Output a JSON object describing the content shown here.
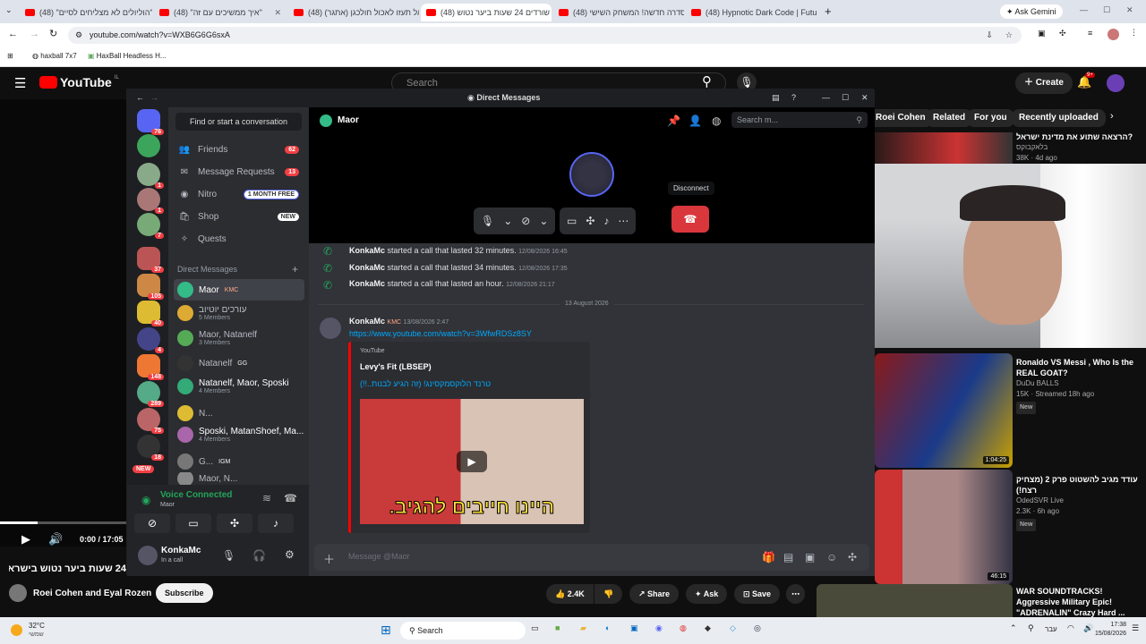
{
  "browser": {
    "tabs": [
      {
        "title": "(48) \"הוליולים לא מצליחים לסיים\"",
        "active": false
      },
      {
        "title": "(48) \"איך ממשיכים עם זה\"",
        "active": false
      },
      {
        "title": "(48) אל תעזו לאכול חולכגן (אתגר)",
        "active": false
      },
      {
        "title": "(48) שורדים 24 שעות ביער נטוש",
        "active": true
      },
      {
        "title": "(48) סדרה חדשה! המשחק השישי",
        "active": false
      },
      {
        "title": "(48) Hypnotic Dark Code | Futu",
        "active": false
      }
    ],
    "new_tab": "+",
    "gemini": "Ask Gemini",
    "url": "youtube.com/watch?v=WXB6G6G6sxA",
    "bookmarks": [
      "haxball 7x7",
      "HaxBall Headless H..."
    ]
  },
  "youtube": {
    "logo": "YouTube",
    "logo_region": "IL",
    "search_placeholder": "Search",
    "create": "Create",
    "notif_count": "9+",
    "chips": [
      "Roei Cohen",
      "Related",
      "For you",
      "Recently uploaded"
    ],
    "player_time": "0:00 / 17:05",
    "video_title": "24 שעות ביער נטוש בישראל",
    "channel": "Roei Cohen and Eyal Rozen",
    "subscribe": "Subscribe",
    "likes": "2.4K",
    "share": "Share",
    "ask": "Ask",
    "save": "Save",
    "recommended": [
      {
        "title": "הרצאה שתוע את מדינת ישראל?",
        "channel": "בלאקבוקס",
        "meta": "38K · 4d ago"
      },
      {
        "title": "Ronaldo VS Messi , Who Is the REAL GOAT?",
        "channel": "DuDu BALLS",
        "meta": "15K · Streamed 18h ago",
        "badge": "New",
        "duration": "1:04:25"
      },
      {
        "title": "עודד מגיב להשטוט פרק 2 (מצחיק רצח!)",
        "channel": "OdedSVR Live",
        "meta": "2.3K · 6h ago",
        "badge": "New",
        "duration": "46:15"
      },
      {
        "title": "WAR SOUNDTRACKS! Aggressive Military Epic! \"ADRENALIN\" Crazy Hard ...",
        "channel": "",
        "meta": ""
      }
    ]
  },
  "discord": {
    "window_title": "Direct Messages",
    "guild_badges": [
      "76",
      "1",
      "1",
      "7",
      "37",
      "105",
      "40",
      "4",
      "148",
      "289",
      "75",
      "18"
    ],
    "new_label": "NEW",
    "find": "Find or start a conversation",
    "nav": [
      {
        "label": "Friends",
        "badge": "62"
      },
      {
        "label": "Message Requests",
        "badge": "13"
      },
      {
        "label": "Nitro",
        "badge": "1 MONTH FREE"
      },
      {
        "label": "Shop",
        "badge": "NEW"
      },
      {
        "label": "Quests",
        "badge": ""
      }
    ],
    "dm_header": "Direct Messages",
    "add": "+",
    "dms": [
      {
        "name": "Maor",
        "tag": "KMC",
        "sub": ""
      },
      {
        "name": "עורכים יוטיוב",
        "tag": "",
        "sub": "5 Members"
      },
      {
        "name": "Maor, Natanelf",
        "tag": "",
        "sub": "3 Members"
      },
      {
        "name": "Natanelf",
        "tag": "GG",
        "sub": ""
      },
      {
        "name": "Natanelf, Maor, Sposki",
        "tag": "",
        "sub": "4 Members"
      },
      {
        "name": "N...",
        "tag": "",
        "sub": ""
      },
      {
        "name": "Sposki, MatanShoef, Ma...",
        "tag": "",
        "sub": "4 Members"
      },
      {
        "name": "G...",
        "tag": "IGM",
        "sub": ""
      },
      {
        "name": "Maor, N...",
        "tag": "",
        "sub": ""
      }
    ],
    "voice": {
      "status": "Voice Connected",
      "channel": "Maor"
    },
    "me": {
      "name": "KonkaMc",
      "status": "In a call"
    },
    "chat_header": "Maor",
    "search_placeholder": "Search m...",
    "disconnect_tooltip": "Disconnect",
    "messages": [
      {
        "author": "KonkaMc",
        "text": "started a call that lasted 32 minutes.",
        "time": "12/08/2026 16:45"
      },
      {
        "author": "KonkaMc",
        "text": "started a call that lasted 34 minutes.",
        "time": "12/08/2026 17:35"
      },
      {
        "author": "KonkaMc",
        "text": "started a call that lasted an hour.",
        "time": "12/08/2026 21:17"
      }
    ],
    "date_divider": "13 August 2026",
    "post": {
      "author": "KonkaMc",
      "tag": "KMC",
      "time": "13/08/2026 2:47",
      "link": "https://www.youtube.com/watch?v=3WfwRDSz8SY",
      "embed_provider": "YouTube",
      "embed_author": "Levy's Fit (LBSEP)",
      "embed_title": "טרנד הלוקסמקסינג! (זה הגיע לבנות..!!)",
      "thumb_caption": "היינו חייבים להגיב."
    },
    "composer_placeholder": "Message @Maor"
  },
  "taskbar": {
    "weather_temp": "32°C",
    "weather_desc": "שמשי",
    "search": "Search",
    "lang": "עבר",
    "time": "17:38",
    "date": "15/08/2026"
  }
}
